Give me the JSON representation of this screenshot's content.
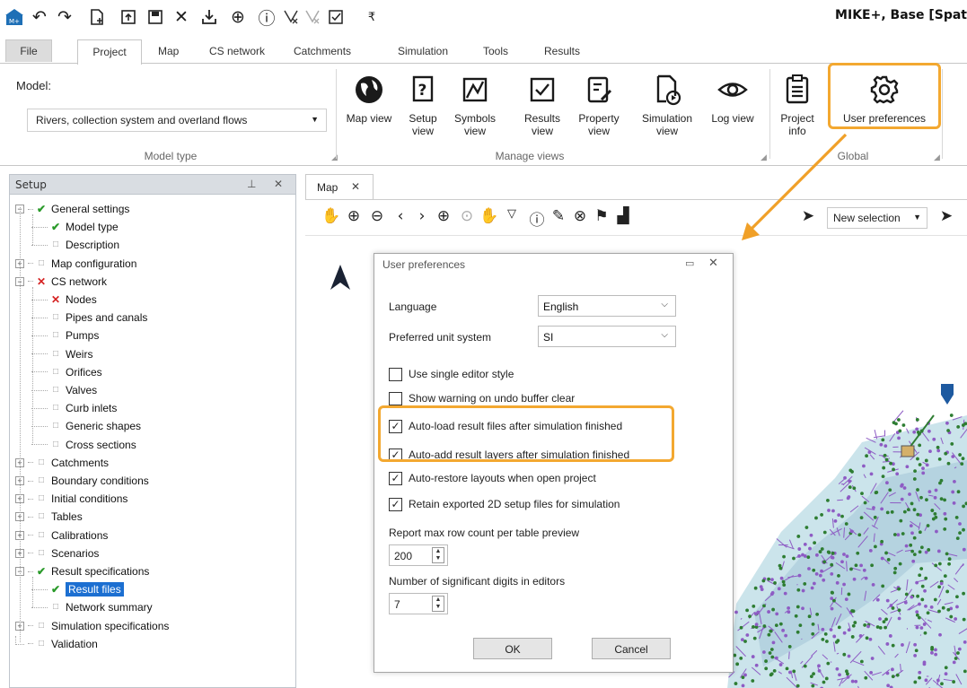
{
  "app_title": "MIKE+, Base [Spat",
  "qat_icons": [
    "app-icon",
    "undo-icon",
    "redo-icon",
    "new-icon",
    "open-icon",
    "save-icon",
    "close-icon",
    "import-icon",
    "globe-icon",
    "info-icon",
    "clear-selection-icon",
    "filter-icon",
    "checkbox-icon",
    "dropdown-icon"
  ],
  "ribbon_tabs": [
    {
      "label": "File"
    },
    {
      "label": "Project"
    },
    {
      "label": "Map"
    },
    {
      "label": "CS network"
    },
    {
      "label": "Catchments"
    },
    {
      "label": "Simulation"
    },
    {
      "label": "Tools"
    },
    {
      "label": "Results"
    }
  ],
  "ribbon": {
    "model_label": "Model:",
    "model_value": "Rivers, collection system and overland flows",
    "group_model_type": "Model type",
    "group_manage_views": "Manage views",
    "group_global": "Global",
    "buttons": {
      "map_view": "Map view",
      "setup_view": "Setup view",
      "symbols_view": "Symbols view",
      "results_view": "Results view",
      "property_view": "Property view",
      "simulation_view": "Simulation view",
      "log_view": "Log view",
      "project_info": "Project info",
      "user_preferences": "User preferences"
    }
  },
  "setup_panel": {
    "title": "Setup",
    "pin": "⊥",
    "close": "✕",
    "tree": [
      {
        "label": "General settings",
        "level": 0,
        "state": "ok",
        "expander": "minus"
      },
      {
        "label": "Model type",
        "level": 1,
        "state": "ok"
      },
      {
        "label": "Description",
        "level": 1,
        "state": "none"
      },
      {
        "label": "Map configuration",
        "level": 0,
        "state": "none",
        "expander": "plus"
      },
      {
        "label": "CS network",
        "level": 0,
        "state": "err",
        "expander": "minus"
      },
      {
        "label": "Nodes",
        "level": 1,
        "state": "err"
      },
      {
        "label": "Pipes and canals",
        "level": 1,
        "state": "none"
      },
      {
        "label": "Pumps",
        "level": 1,
        "state": "none"
      },
      {
        "label": "Weirs",
        "level": 1,
        "state": "none"
      },
      {
        "label": "Orifices",
        "level": 1,
        "state": "none"
      },
      {
        "label": "Valves",
        "level": 1,
        "state": "none"
      },
      {
        "label": "Curb inlets",
        "level": 1,
        "state": "none"
      },
      {
        "label": "Generic shapes",
        "level": 1,
        "state": "none"
      },
      {
        "label": "Cross sections",
        "level": 1,
        "state": "none"
      },
      {
        "label": "Catchments",
        "level": 0,
        "state": "none",
        "expander": "plus"
      },
      {
        "label": "Boundary conditions",
        "level": 0,
        "state": "none",
        "expander": "plus"
      },
      {
        "label": "Initial conditions",
        "level": 0,
        "state": "none",
        "expander": "plus"
      },
      {
        "label": "Tables",
        "level": 0,
        "state": "none",
        "expander": "plus"
      },
      {
        "label": "Calibrations",
        "level": 0,
        "state": "none",
        "expander": "plus"
      },
      {
        "label": "Scenarios",
        "level": 0,
        "state": "none",
        "expander": "plus"
      },
      {
        "label": "Result specifications",
        "level": 0,
        "state": "ok",
        "expander": "minus"
      },
      {
        "label": "Result files",
        "level": 1,
        "state": "ok",
        "selected": true
      },
      {
        "label": "Network summary",
        "level": 1,
        "state": "none"
      },
      {
        "label": "Simulation specifications",
        "level": 0,
        "state": "none",
        "expander": "plus"
      },
      {
        "label": "Validation",
        "level": 0,
        "state": "none"
      }
    ]
  },
  "map": {
    "tab_label": "Map",
    "tab_close": "✕",
    "selection_mode": "New selection",
    "toolbar_icons": [
      "pan-icon",
      "zoom-in-icon",
      "zoom-out-icon",
      "back-icon",
      "forward-icon",
      "full-extent-icon",
      "zoom-selection-icon",
      "zoom-layer-icon",
      "clear-selection-icon",
      "identify-icon",
      "edit-icon",
      "network-icon",
      "flag-icon",
      "chart-icon",
      "select-icon",
      "select-filter-icon"
    ]
  },
  "dialog": {
    "title": "User preferences",
    "language_label": "Language",
    "language_value": "English",
    "unit_label": "Preferred unit system",
    "unit_value": "SI",
    "options": [
      {
        "label": "Use single editor style",
        "checked": false
      },
      {
        "label": "Show warning on undo buffer clear",
        "checked": false
      },
      {
        "label": "Auto-load result files after simulation finished",
        "checked": true
      },
      {
        "label": "Auto-add result layers after simulation finished",
        "checked": true
      },
      {
        "label": "Auto-restore layouts when open project",
        "checked": true
      },
      {
        "label": "Retain exported 2D setup files for simulation",
        "checked": true
      }
    ],
    "max_rows_label": "Report max row count per table preview",
    "max_rows_value": "200",
    "sig_digits_label": "Number of significant digits in editors",
    "sig_digits_value": "7",
    "ok": "OK",
    "cancel": "Cancel"
  },
  "colors": {
    "highlight": "#f3a830",
    "selection": "#1c6fd1",
    "status_ok": "#2a9a2a",
    "status_err": "#d52222",
    "network_nodes": "#2e7d32",
    "network_links": "#8e5cc4",
    "flood_area": "#b9dbe4"
  }
}
